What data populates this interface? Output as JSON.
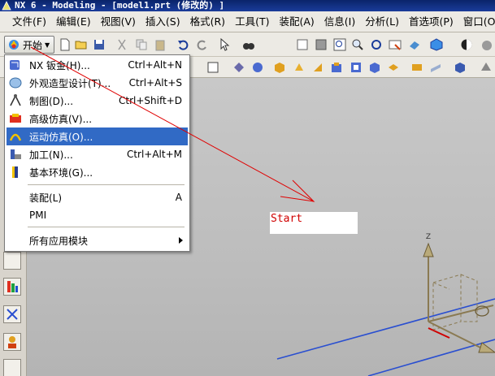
{
  "window": {
    "title": "NX 6 - Modeling - [model1.prt (修改的) ]"
  },
  "menubar": {
    "items": [
      "文件(F)",
      "编辑(E)",
      "视图(V)",
      "插入(S)",
      "格式(R)",
      "工具(T)",
      "装配(A)",
      "信息(I)",
      "分析(L)",
      "首选项(P)",
      "窗口(O)"
    ]
  },
  "toolbar": {
    "start_label": "开始"
  },
  "start_menu": {
    "items": [
      {
        "label": "NX 钣金(H)...",
        "shortcut": "Ctrl+Alt+N",
        "icon": "sheet-metal-icon"
      },
      {
        "label": "外观造型设计(T)...",
        "shortcut": "Ctrl+Alt+S",
        "icon": "shape-studio-icon"
      },
      {
        "label": "制图(D)...",
        "shortcut": "Ctrl+Shift+D",
        "icon": "drafting-icon"
      },
      {
        "label": "高级仿真(V)...",
        "shortcut": "",
        "icon": "advanced-simulation-icon"
      },
      {
        "label": "运动仿真(O)...",
        "shortcut": "",
        "icon": "motion-simulation-icon",
        "selected": true
      },
      {
        "label": "加工(N)...",
        "shortcut": "Ctrl+Alt+M",
        "icon": "manufacturing-icon"
      },
      {
        "label": "基本环境(G)...",
        "shortcut": "",
        "icon": "gateway-icon"
      },
      {
        "label": "装配(L)",
        "shortcut": "A"
      },
      {
        "label": "PMI",
        "shortcut": ""
      },
      {
        "label": "所有应用模块",
        "shortcut": ""
      }
    ]
  },
  "viewport": {
    "annotation": "Start",
    "axis_label_z": "Z"
  },
  "colors": {
    "selection": "#316ac5",
    "annotation_arrow": "#e00000",
    "annotation_text": "#d00000",
    "datum_line": "#2a4fd0",
    "csys": "#8a7a52"
  }
}
